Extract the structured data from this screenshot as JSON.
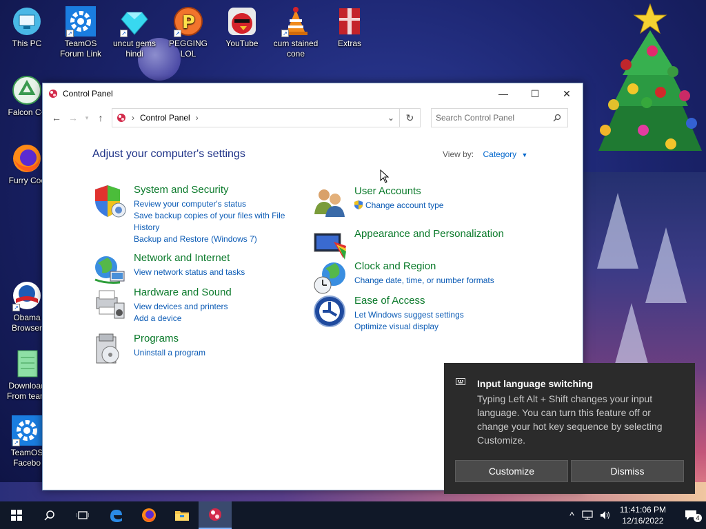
{
  "desktop": {
    "icons": [
      {
        "label": "This PC",
        "icon": "this-pc-icon"
      },
      {
        "label": "TeamOS Forum Link",
        "icon": "gear-icon"
      },
      {
        "label": "uncut gems hindi",
        "icon": "diamond-icon"
      },
      {
        "label": "PEGGING LOL",
        "icon": "pegging-icon"
      },
      {
        "label": "YouTube",
        "icon": "angry-bird-icon"
      },
      {
        "label": "cum stained cone",
        "icon": "vlc-cone-icon"
      },
      {
        "label": "Extras",
        "icon": "gift-box-icon"
      },
      {
        "label": "Falcon C+",
        "icon": "recycle-icon"
      },
      {
        "label": "Furry Coc",
        "icon": "firefox-icon"
      },
      {
        "label": "Obama Browser",
        "icon": "obama-logo-icon"
      },
      {
        "label": "Download From team",
        "icon": "notepad-icon"
      },
      {
        "label": "TeamOS Facebo",
        "icon": "gear-icon"
      }
    ]
  },
  "window": {
    "title": "Control Panel",
    "controls": {
      "minimize": "—",
      "maximize": "☐",
      "close": "✕"
    },
    "breadcrumb": [
      "Control Panel"
    ],
    "search_placeholder": "Search Control Panel",
    "heading": "Adjust your computer's settings",
    "view_by_label": "View by:",
    "view_by_value": "Category",
    "categories_left": [
      {
        "title": "System and Security",
        "icon": "shield-icon",
        "links": [
          "Review your computer's status",
          "Save backup copies of your files with File History",
          "Backup and Restore (Windows 7)"
        ]
      },
      {
        "title": "Network and Internet",
        "icon": "network-globe-icon",
        "links": [
          "View network status and tasks"
        ]
      },
      {
        "title": "Hardware and Sound",
        "icon": "printer-icon",
        "links": [
          "View devices and printers",
          "Add a device"
        ]
      },
      {
        "title": "Programs",
        "icon": "programs-icon",
        "links": [
          "Uninstall a program"
        ]
      }
    ],
    "categories_right": [
      {
        "title": "User Accounts",
        "icon": "users-icon",
        "links": [
          "Change account type"
        ]
      },
      {
        "title": "Appearance and Personalization",
        "icon": "display-palette-icon",
        "links": []
      },
      {
        "title": "Clock and Region",
        "icon": "clock-globe-icon",
        "links": [
          "Change date, time, or number formats"
        ]
      },
      {
        "title": "Ease of Access",
        "icon": "ease-of-access-icon",
        "links": [
          "Let Windows suggest settings",
          "Optimize visual display"
        ]
      }
    ]
  },
  "toast": {
    "title": "Input language switching",
    "body": "Typing Left Alt + Shift changes your input language. You can turn this feature off or change your hot key sequence by selecting Customize.",
    "customize": "Customize",
    "dismiss": "Dismiss"
  },
  "taskbar": {
    "time": "11:41:06 PM",
    "date": "12/16/2022",
    "notification_count": "4"
  }
}
